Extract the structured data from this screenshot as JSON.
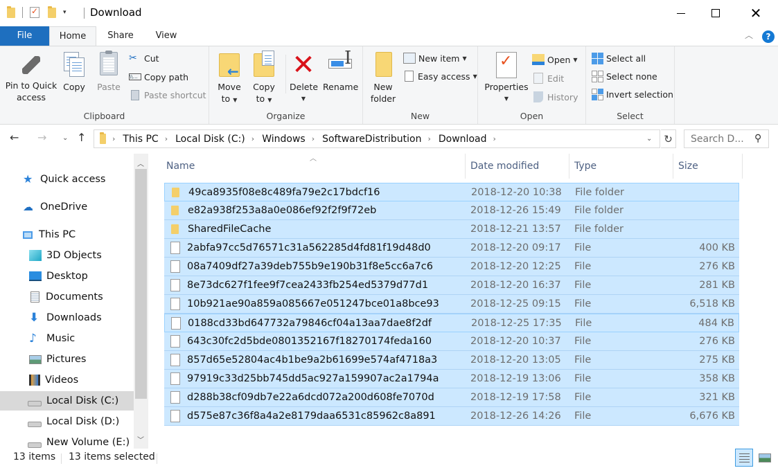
{
  "window": {
    "title": "Download",
    "minimize_label": "Minimize",
    "maximize_label": "Maximize",
    "close_label": "Close"
  },
  "ribbon_tabs": [
    {
      "label": "File"
    },
    {
      "label": "Home"
    },
    {
      "label": "Share"
    },
    {
      "label": "View"
    }
  ],
  "ribbon": {
    "clipboard": {
      "label": "Clipboard",
      "pin_line1": "Pin to Quick",
      "pin_line2": "access",
      "copy": "Copy",
      "paste": "Paste",
      "cut": "Cut",
      "copy_path": "Copy path",
      "paste_shortcut": "Paste shortcut"
    },
    "organize": {
      "label": "Organize",
      "move_line1": "Move",
      "move_line2": "to",
      "copy_line1": "Copy",
      "copy_line2": "to",
      "delete": "Delete",
      "rename": "Rename"
    },
    "new": {
      "label": "New",
      "new_folder_line1": "New",
      "new_folder_line2": "folder",
      "new_item": "New item",
      "easy_access": "Easy access"
    },
    "open": {
      "label": "Open",
      "properties": "Properties",
      "open": "Open",
      "edit": "Edit",
      "history": "History"
    },
    "select": {
      "label": "Select",
      "select_all": "Select all",
      "select_none": "Select none",
      "invert_selection": "Invert selection"
    }
  },
  "address": {
    "breadcrumbs": [
      "This PC",
      "Local Disk (C:)",
      "Windows",
      "SoftwareDistribution",
      "Download"
    ],
    "search_placeholder": "Search D..."
  },
  "sidebar": {
    "items": [
      {
        "label": "Quick access",
        "icon": "star-icon"
      },
      {
        "label": "OneDrive",
        "icon": "cloud-icon"
      },
      {
        "label": "This PC",
        "icon": "computer-icon"
      },
      {
        "label": "3D Objects",
        "icon": "cube-icon"
      },
      {
        "label": "Desktop",
        "icon": "desktop-icon"
      },
      {
        "label": "Documents",
        "icon": "documents-icon"
      },
      {
        "label": "Downloads",
        "icon": "download-arrow-icon"
      },
      {
        "label": "Music",
        "icon": "music-note-icon"
      },
      {
        "label": "Pictures",
        "icon": "pictures-icon"
      },
      {
        "label": "Videos",
        "icon": "film-icon"
      },
      {
        "label": "Local Disk (C:)",
        "icon": "system-drive-icon"
      },
      {
        "label": "Local Disk (D:)",
        "icon": "drive-icon"
      },
      {
        "label": "New Volume (E:)",
        "icon": "drive-icon"
      }
    ],
    "selected_index": 10
  },
  "list": {
    "columns": [
      "Name",
      "Date modified",
      "Type",
      "Size"
    ],
    "rows": [
      {
        "name": "49ca8935f08e8c489fa79e2c17bdcf16",
        "date": "2018-12-20 10:38",
        "type": "File folder",
        "size": "",
        "kind": "folder"
      },
      {
        "name": "e82a938f253a8a0e086ef92f2f9f72eb",
        "date": "2018-12-26 15:49",
        "type": "File folder",
        "size": "",
        "kind": "folder"
      },
      {
        "name": "SharedFileCache",
        "date": "2018-12-21 13:57",
        "type": "File folder",
        "size": "",
        "kind": "folder"
      },
      {
        "name": "2abfa97cc5d76571c31a562285d4fd81f19d48d0",
        "date": "2018-12-20 09:17",
        "type": "File",
        "size": "400 KB",
        "kind": "file"
      },
      {
        "name": "08a7409df27a39deb755b9e190b31f8e5cc6a7c6",
        "date": "2018-12-20 12:25",
        "type": "File",
        "size": "276 KB",
        "kind": "file"
      },
      {
        "name": "8e73dc627f1fee9f7cea2433fb254ed5379d77d1",
        "date": "2018-12-20 16:37",
        "type": "File",
        "size": "281 KB",
        "kind": "file"
      },
      {
        "name": "10b921ae90a859a085667e051247bce01a8bce93",
        "date": "2018-12-25 09:15",
        "type": "File",
        "size": "6,518 KB",
        "kind": "file"
      },
      {
        "name": "0188cd33bd647732a79846cf04a13aa7dae8f2df",
        "date": "2018-12-25 17:35",
        "type": "File",
        "size": "484 KB",
        "kind": "file"
      },
      {
        "name": "643c30fc2d5bde0801352167f18270174feda160",
        "date": "2018-12-20 10:37",
        "type": "File",
        "size": "276 KB",
        "kind": "file"
      },
      {
        "name": "857d65e52804ac4b1be9a2b61699e574af4718a3",
        "date": "2018-12-20 13:05",
        "type": "File",
        "size": "275 KB",
        "kind": "file"
      },
      {
        "name": "97919c33d25bb745dd5ac927a159907ac2a1794a",
        "date": "2018-12-19 13:06",
        "type": "File",
        "size": "358 KB",
        "kind": "file"
      },
      {
        "name": "d288b38cf09db7e22a6dcd072a200d608fe7070d",
        "date": "2018-12-19 17:58",
        "type": "File",
        "size": "321 KB",
        "kind": "file"
      },
      {
        "name": "d575e87c36f8a4a2e8179daa6531c85962c8a891",
        "date": "2018-12-26 14:26",
        "type": "File",
        "size": "6,676 KB",
        "kind": "file"
      }
    ]
  },
  "status": {
    "item_count": "13 items",
    "selected_count": "13 items selected"
  },
  "colors": {
    "file_tab": "#1e6fbf",
    "selection": "#cce8ff",
    "selection_border": "#99d1ff",
    "header_text": "#4d6082"
  }
}
